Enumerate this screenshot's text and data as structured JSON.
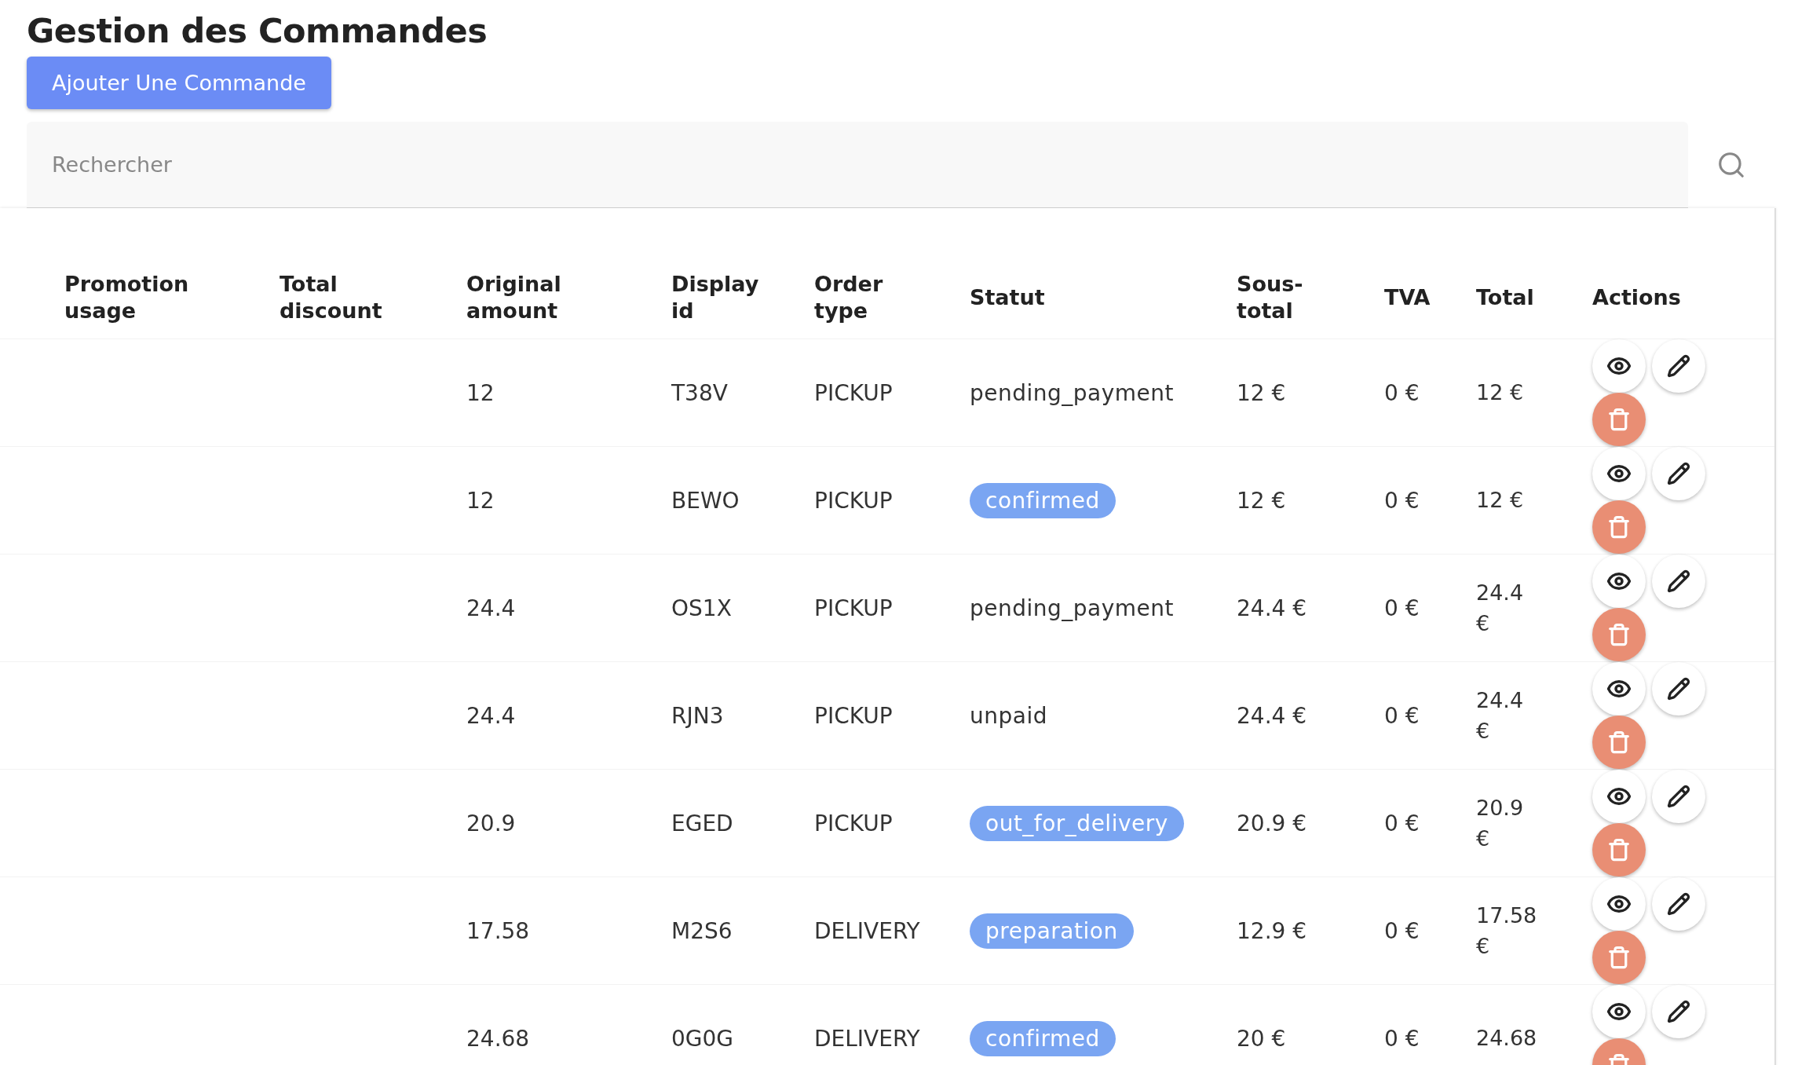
{
  "title": "Gestion des Commandes",
  "add_button": "Ajouter Une Commande",
  "search": {
    "placeholder": "Rechercher"
  },
  "table": {
    "columns": [
      "Promotion usage",
      "Total discount",
      "Original amount",
      "Display id",
      "Order type",
      "Statut",
      "Sous-total",
      "TVA",
      "Total",
      "Actions"
    ],
    "rows": [
      {
        "original_amount": "12",
        "display_id": "T38V",
        "order_type": "PICKUP",
        "status": {
          "label": "pending_payment",
          "badge": false
        },
        "subtotal": "12 €",
        "tva": "0 €",
        "total": "12 €"
      },
      {
        "original_amount": "12",
        "display_id": "BEWO",
        "order_type": "PICKUP",
        "status": {
          "label": "confirmed",
          "badge": true
        },
        "subtotal": "12 €",
        "tva": "0 €",
        "total": "12 €"
      },
      {
        "original_amount": "24.4",
        "display_id": "OS1X",
        "order_type": "PICKUP",
        "status": {
          "label": "pending_payment",
          "badge": false
        },
        "subtotal": "24.4 €",
        "tva": "0 €",
        "total": "24.4 €"
      },
      {
        "original_amount": "24.4",
        "display_id": "RJN3",
        "order_type": "PICKUP",
        "status": {
          "label": "unpaid",
          "badge": false
        },
        "subtotal": "24.4 €",
        "tva": "0 €",
        "total": "24.4 €"
      },
      {
        "original_amount": "20.9",
        "display_id": "EGED",
        "order_type": "PICKUP",
        "status": {
          "label": "out_for_delivery",
          "badge": true
        },
        "subtotal": "20.9 €",
        "tva": "0 €",
        "total": "20.9 €"
      },
      {
        "original_amount": "17.58",
        "display_id": "M2S6",
        "order_type": "DELIVERY",
        "status": {
          "label": "preparation",
          "badge": true
        },
        "subtotal": "12.9 €",
        "tva": "0 €",
        "total": "17.58 €"
      },
      {
        "original_amount": "24.68",
        "display_id": "0G0G",
        "order_type": "DELIVERY",
        "status": {
          "label": "confirmed",
          "badge": true
        },
        "subtotal": "20 €",
        "tva": "0 €",
        "total": "24.68"
      }
    ]
  }
}
